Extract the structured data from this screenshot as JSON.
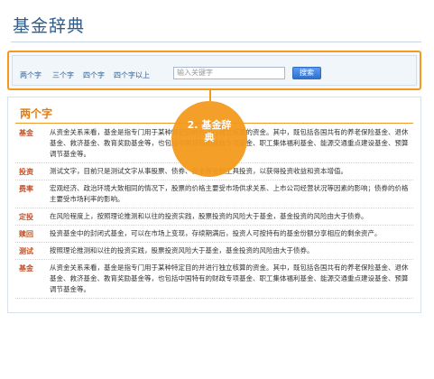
{
  "header": {
    "title": "基金辞典"
  },
  "search": {
    "filters": [
      "两个字",
      "三个字",
      "四个字",
      "四个字以上"
    ],
    "placeholder": "输入关键字",
    "button_label": "搜索"
  },
  "section": {
    "heading": "两个字",
    "entries": [
      {
        "term": "基金",
        "definition": "从资金关系来看，基金是指专门用于某种特定目的并进行独立核算的资金。其中，既包括各国共有的养老保险基金、退休基金、救济基金、教育奖励基金等，也包括中国特有的财政专项基金、职工集体福利基金、能源交通重点建设基金、预算调节基金等。"
      },
      {
        "term": "投资",
        "definition": "测试文字，目前只是测试文字从事股票、债券、基金等金融工具投资，以获得投资收益和资本增值。"
      },
      {
        "term": "费率",
        "definition": "宏观经济、政治环境大致相同的情况下，股票的价格主要受市场供求关系、上市公司经营状况等因素的影响；债券的价格主要受市场利率的影响。"
      },
      {
        "term": "定投",
        "definition": "在风险程度上，按照理论推测和以往的投资实践，股票投资的风险大于基金，基金投资的风险由大于债券。"
      },
      {
        "term": "赎回",
        "definition": "投资基金中的封闭式基金，可以在市场上变现，存续期满后，投资人可按持有的基金份额分享相应的剩余资产。"
      },
      {
        "term": "测试",
        "definition": "按照理论推测和以往的投资实践，股票投资风险大于基金，基金投资的风险由大于债券。"
      },
      {
        "term": "基金",
        "definition": "从资金关系来看，基金是指专门用于某种特定目的并进行独立核算的资金。其中，既包括各国共有的养老保险基金、退休基金、救济基金、教育奖励基金等，也包括中国特有的财政专项基金、职工集体福利基金、能源交通重点建设基金、预算调节基金等。"
      }
    ]
  },
  "callout": {
    "line1": "2. 基金辞",
    "line2": "典"
  },
  "colors": {
    "accent": "#f39a1d",
    "title": "#2a5e96",
    "term": "#c0522a"
  }
}
